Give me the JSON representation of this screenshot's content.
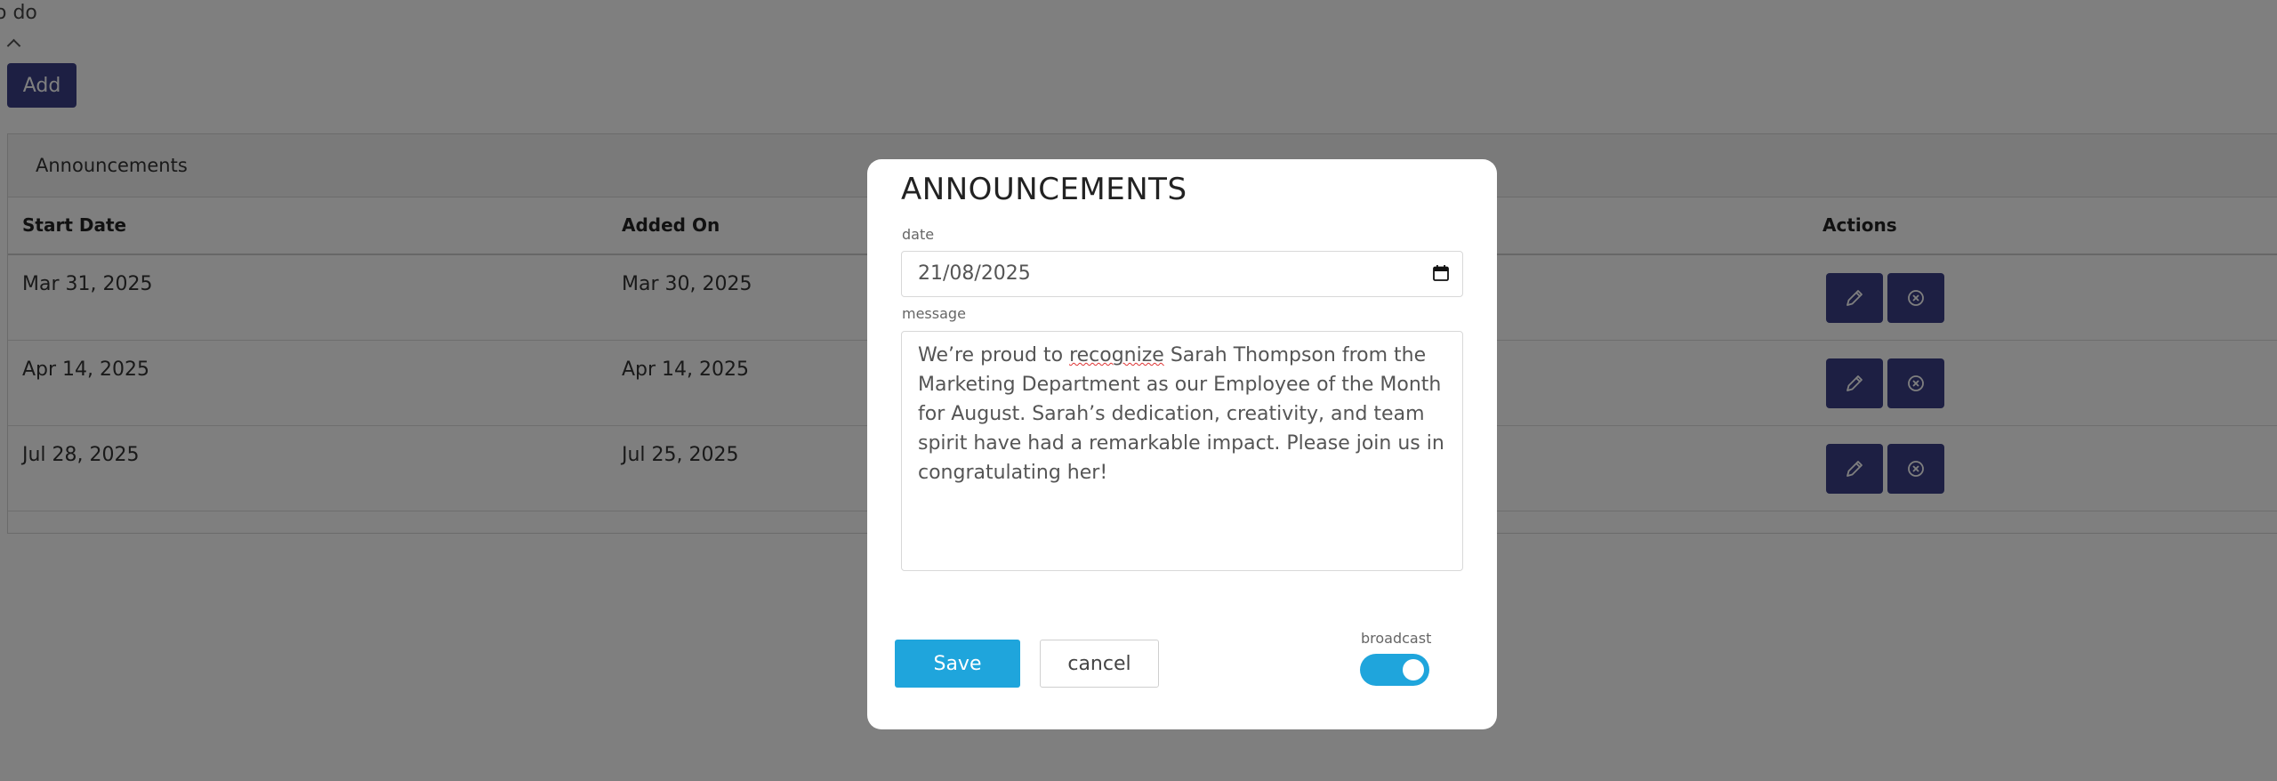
{
  "page": {
    "top_label": "o do",
    "add_label": "Add",
    "panel_title": "Announcements",
    "columns": {
      "start_date": "Start Date",
      "added_on": "Added On",
      "actions": "Actions"
    },
    "rows": [
      {
        "start_date": "Mar 31, 2025",
        "added_on": "Mar 30, 2025"
      },
      {
        "start_date": "Apr 14, 2025",
        "added_on": "Apr 14, 2025"
      },
      {
        "start_date": "Jul 28, 2025",
        "added_on": "Jul 25, 2025"
      }
    ]
  },
  "modal": {
    "title": "ANNOUNCEMENTS",
    "date_label": "date",
    "date_value": "21/08/2025",
    "message_label": "message",
    "message_prefix": "We’re proud to ",
    "message_misspelled": "recognize",
    "message_suffix": " Sarah Thompson from the Marketing Department as our Employee of the Month for August. Sarah’s dedication, creativity, and team spirit have had a remarkable impact. Please join us in congratulating her!",
    "save_label": "Save",
    "cancel_label": "cancel",
    "broadcast_label": "broadcast",
    "broadcast_on": true
  },
  "colors": {
    "navy": "#3a3f87",
    "accent": "#1fa5dc",
    "overlay": "rgba(0,0,0,0.5)"
  },
  "icons": {
    "edit": "pencil-icon",
    "delete": "close-circle-icon",
    "calendar": "calendar-icon"
  }
}
